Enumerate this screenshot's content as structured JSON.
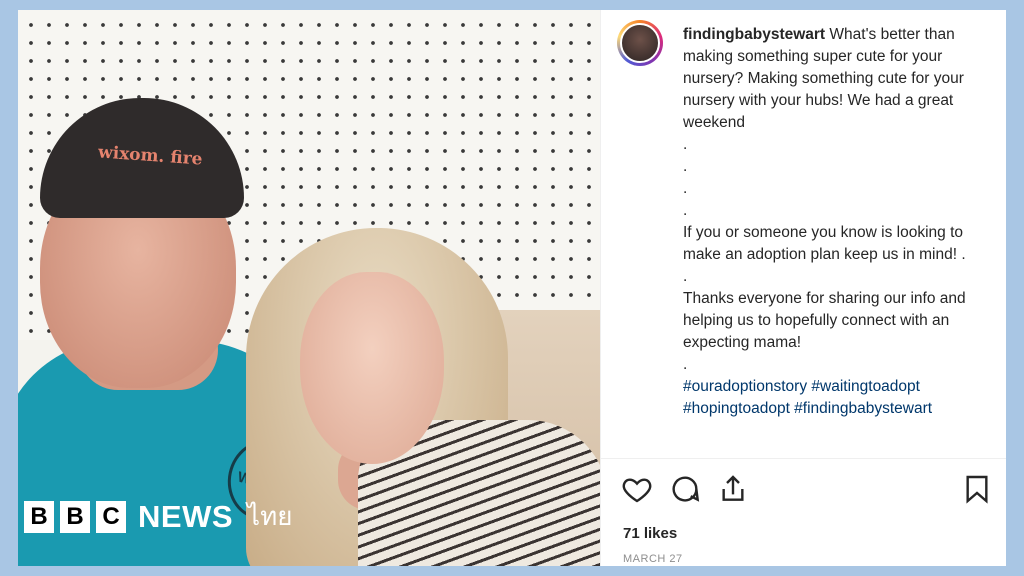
{
  "photo": {
    "cap_text": "wixom. fire",
    "shirt_logo_text": "WIXOM",
    "watermark": {
      "bbc_letters": [
        "B",
        "B",
        "C"
      ],
      "news": "NEWS",
      "language": "ไทย"
    }
  },
  "post": {
    "username": "findingbabystewart",
    "caption_lines": [
      "What's better than making something super cute for your nursery? Making something cute for your nursery with your hubs! We had a great weekend",
      ".",
      ".",
      ".",
      ".",
      "If you or someone you know is looking to make an adoption plan keep us in mind! .",
      ".",
      "Thanks everyone for sharing our info and helping us to hopefully connect with an expecting mama!",
      "."
    ],
    "hashtags": "#ouradoptionstory #waitingtoadopt #hopingtoadopt #findingbabystewart",
    "likes": "71 likes",
    "date": "MARCH 27",
    "icons": [
      "heart-icon",
      "comment-icon",
      "share-icon",
      "bookmark-icon"
    ]
  },
  "colors": {
    "background": "#a9c6e4",
    "hashtag": "#00376b",
    "text": "#262626"
  }
}
